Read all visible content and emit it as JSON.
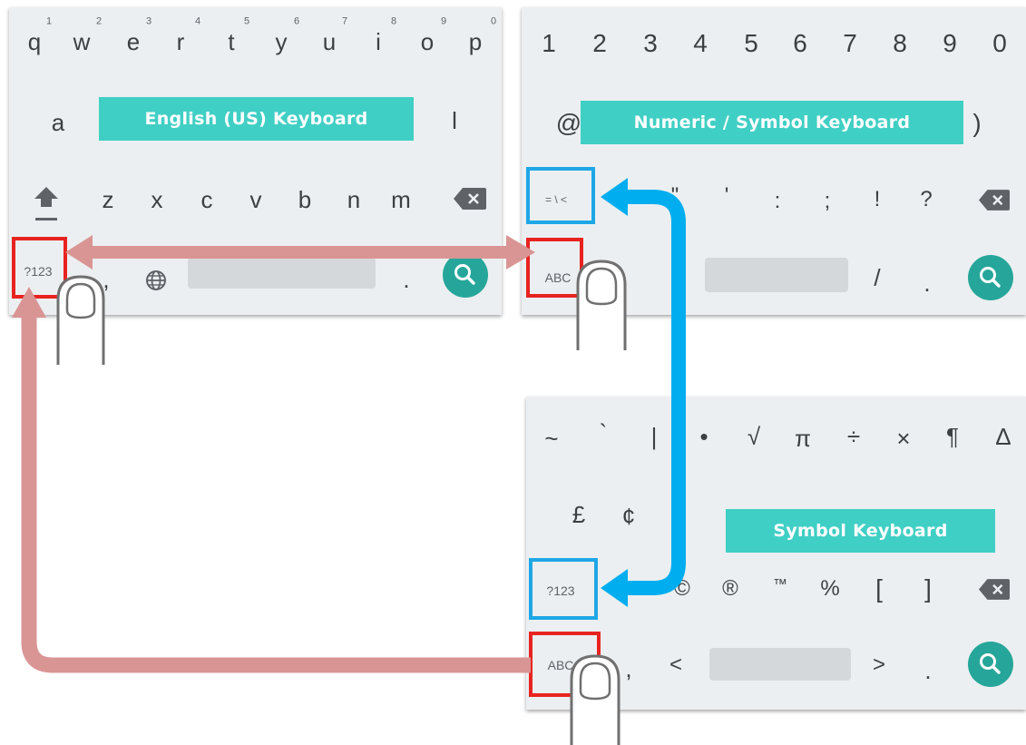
{
  "keyboards": {
    "english": {
      "title": "English (US) Keyboard",
      "row1": [
        {
          "key": "q",
          "hint": "1"
        },
        {
          "key": "w",
          "hint": "2"
        },
        {
          "key": "e",
          "hint": "3"
        },
        {
          "key": "r",
          "hint": "4"
        },
        {
          "key": "t",
          "hint": "5"
        },
        {
          "key": "y",
          "hint": "6"
        },
        {
          "key": "u",
          "hint": "7"
        },
        {
          "key": "i",
          "hint": "8"
        },
        {
          "key": "o",
          "hint": "9"
        },
        {
          "key": "p",
          "hint": "0"
        }
      ],
      "row2_visible": [
        "a",
        "l"
      ],
      "row3": [
        "z",
        "x",
        "c",
        "v",
        "b",
        "n",
        "m"
      ],
      "mode_key": "?123",
      "comma": ",",
      "period": ".",
      "icons": [
        "shift-icon",
        "backspace-icon",
        "globe-icon",
        "search-icon"
      ]
    },
    "numeric": {
      "title": "Numeric / Symbol Keyboard",
      "row1": [
        "1",
        "2",
        "3",
        "4",
        "5",
        "6",
        "7",
        "8",
        "9",
        "0"
      ],
      "row2_visible": [
        "@",
        ")"
      ],
      "row3": [
        "\"",
        "'",
        ":",
        ";",
        "!",
        "?"
      ],
      "more_key": "= \\ <",
      "mode_key": "ABC",
      "slash": "/",
      "period": ".",
      "icons": [
        "backspace-icon",
        "search-icon"
      ]
    },
    "symbol": {
      "title": "Symbol Keyboard",
      "row1": [
        "~",
        "`",
        "|",
        "•",
        "√",
        "π",
        "÷",
        "×",
        "¶",
        "∆"
      ],
      "row2_visible": [
        "£",
        "¢"
      ],
      "row3": [
        "©",
        "®",
        "™",
        "%",
        "[",
        "]"
      ],
      "back_key": "?123",
      "mode_key": "ABC",
      "row4": [
        ",",
        "<",
        ">",
        "."
      ],
      "icons": [
        "backspace-icon",
        "search-icon"
      ]
    }
  },
  "colors": {
    "keyboard_bg": "#eceff1",
    "key_text": "#3c4043",
    "callout_bg": "#40cfc4",
    "search_accent": "#26a69a",
    "abc_highlight": "#e8231f",
    "symbol_highlight": "#1ea7e6",
    "pink_arrow": "#d99594",
    "blue_arrow": "#00aeef"
  }
}
